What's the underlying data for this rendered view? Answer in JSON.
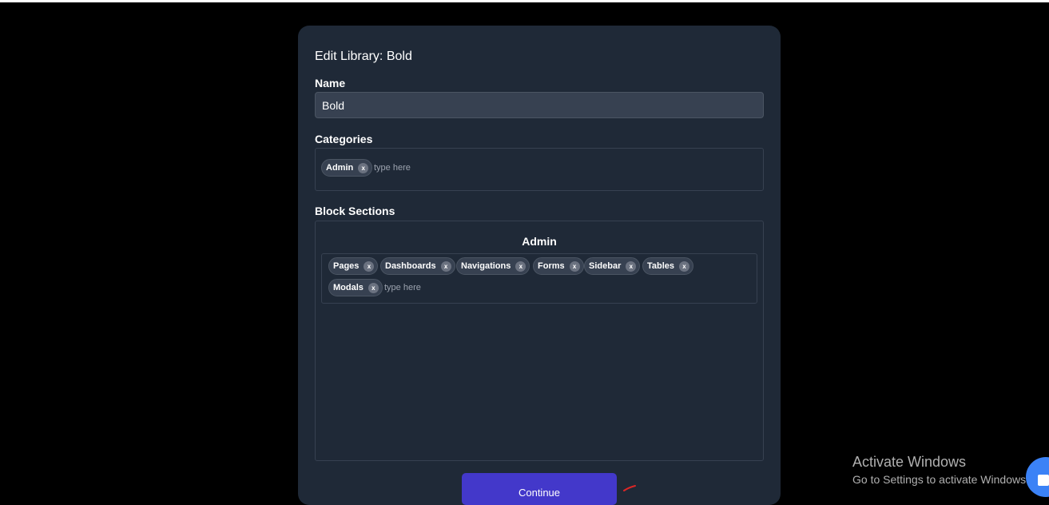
{
  "form": {
    "title": "Edit Library: Bold",
    "name_label": "Name",
    "name_value": "Bold",
    "categories_label": "Categories",
    "categories": [
      {
        "label": "Admin",
        "remove": "x"
      }
    ],
    "categories_placeholder": "type here",
    "block_sections_label": "Block Sections",
    "sections": [
      {
        "heading": "Admin",
        "tags": [
          {
            "label": "Pages",
            "remove": "x"
          },
          {
            "label": "Dashboards",
            "remove": "x"
          },
          {
            "label": "Navigations",
            "remove": "x"
          },
          {
            "label": "Forms",
            "remove": "x"
          },
          {
            "label": "Sidebar",
            "remove": "x"
          },
          {
            "label": "Tables",
            "remove": "x"
          },
          {
            "label": "Modals",
            "remove": "x"
          }
        ],
        "placeholder": "type here"
      }
    ],
    "continue_label": "Continue"
  },
  "watermark": {
    "title": "Activate Windows",
    "subtitle": "Go to Settings to activate Windows."
  },
  "colors": {
    "background": "#000000",
    "panel": "#1f2937",
    "input": "#374151",
    "primary_button": "#4338ca",
    "fab": "#3b82f6"
  },
  "icons": {
    "tag_remove": "close-icon",
    "fab": "chat-icon"
  }
}
